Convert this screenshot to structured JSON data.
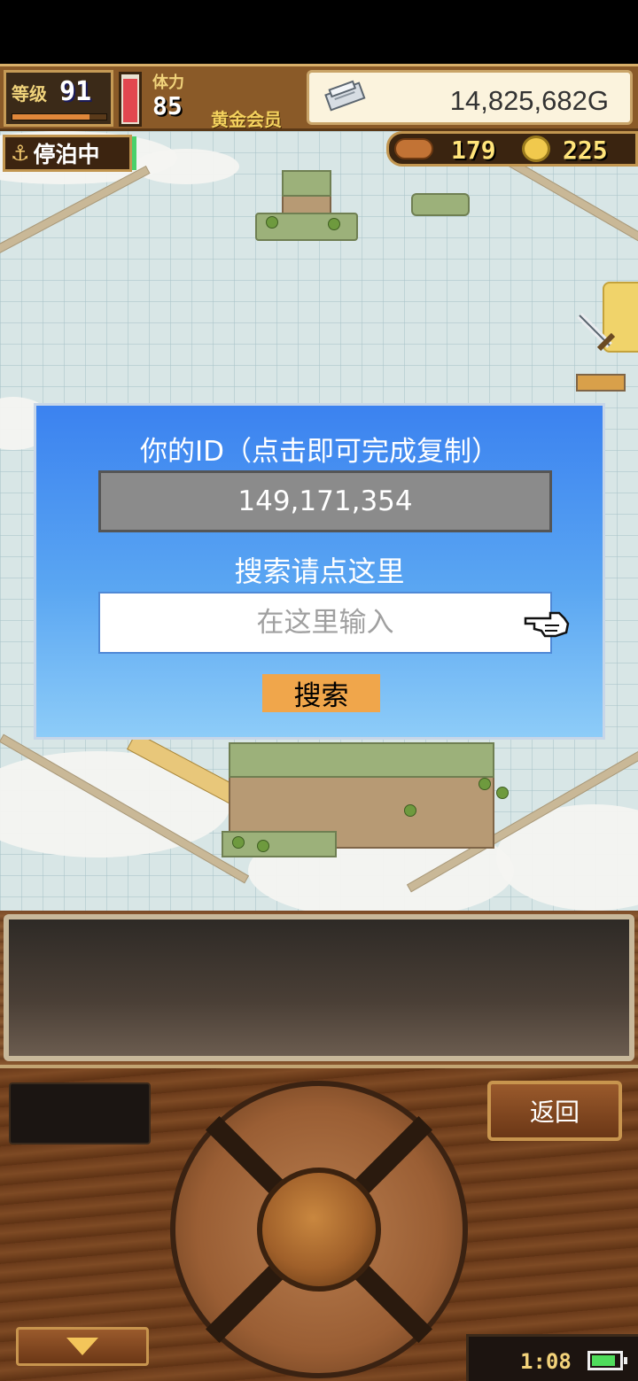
{
  "hud": {
    "level_label": "等级",
    "level_value": "91",
    "exp_fraction": 0.82,
    "stamina_label": "体力",
    "stamina_value": "85",
    "stamina_fraction": 0.95,
    "member_label": "黄金会员",
    "money_value": "14,825,682G"
  },
  "status": {
    "anchor_label": "停泊中",
    "anchor_icon": "anchor-icon"
  },
  "resources": {
    "ticket_value": "179",
    "coin_value": "225"
  },
  "dialog": {
    "title": "你的ID（点击即可完成复制）",
    "id_value": "149,171,354",
    "search_prompt": "搜索请点这里",
    "search_placeholder": "在这里输入",
    "search_button_label": "搜索"
  },
  "bottom": {
    "back_button_label": "返回",
    "clock": "1:08",
    "battery_fraction": 0.8
  },
  "colors": {
    "dialog_top": "#3b82f0",
    "dialog_bottom": "#8dccf8",
    "search_button": "#f0a64b",
    "wood": "#7a4a26"
  }
}
